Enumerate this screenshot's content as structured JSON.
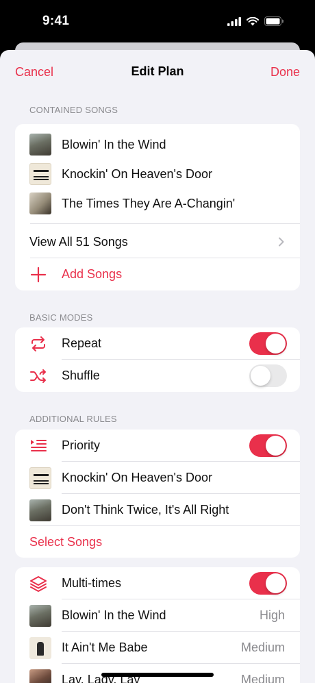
{
  "status": {
    "time": "9:41"
  },
  "nav": {
    "cancel": "Cancel",
    "title": "Edit Plan",
    "done": "Done"
  },
  "contained": {
    "header": "CONTAINED SONGS",
    "songs": [
      {
        "title": "Blowin' In the Wind",
        "art": "album-art-freewheelin"
      },
      {
        "title": "Knockin' On Heaven's Door",
        "art": "album-art-pat-garrett"
      },
      {
        "title": "The Times They Are A-Changin'",
        "art": "album-art-times-changin"
      }
    ],
    "view_all": "View All 51 Songs",
    "add_songs": "Add Songs"
  },
  "basic": {
    "header": "BASIC MODES",
    "repeat": {
      "label": "Repeat",
      "on": true,
      "icon": "repeat-icon"
    },
    "shuffle": {
      "label": "Shuffle",
      "on": false,
      "icon": "shuffle-icon"
    }
  },
  "additional": {
    "header": "ADDITIONAL RULES",
    "priority": {
      "label": "Priority",
      "on": true,
      "icon": "priority-list-icon"
    },
    "songs": [
      {
        "title": "Knockin' On Heaven's Door",
        "art": "album-art-pat-garrett"
      },
      {
        "title": "Don't Think Twice, It's All Right",
        "art": "album-art-freewheelin"
      }
    ],
    "select_songs": "Select Songs"
  },
  "multi": {
    "label": "Multi-times",
    "on": true,
    "icon": "stack-layers-icon",
    "songs": [
      {
        "title": "Blowin' In the Wind",
        "level": "High",
        "art": "album-art-freewheelin"
      },
      {
        "title": "It Ain't Me Babe",
        "level": "Medium",
        "art": "album-art-another-side"
      },
      {
        "title": "Lay, Lady, Lay",
        "level": "Medium",
        "art": "album-art-nashville-skyline"
      }
    ]
  },
  "colors": {
    "accent": "#e9304b",
    "background": "#f2f2f7",
    "secondary_text": "#8a8a8e"
  }
}
